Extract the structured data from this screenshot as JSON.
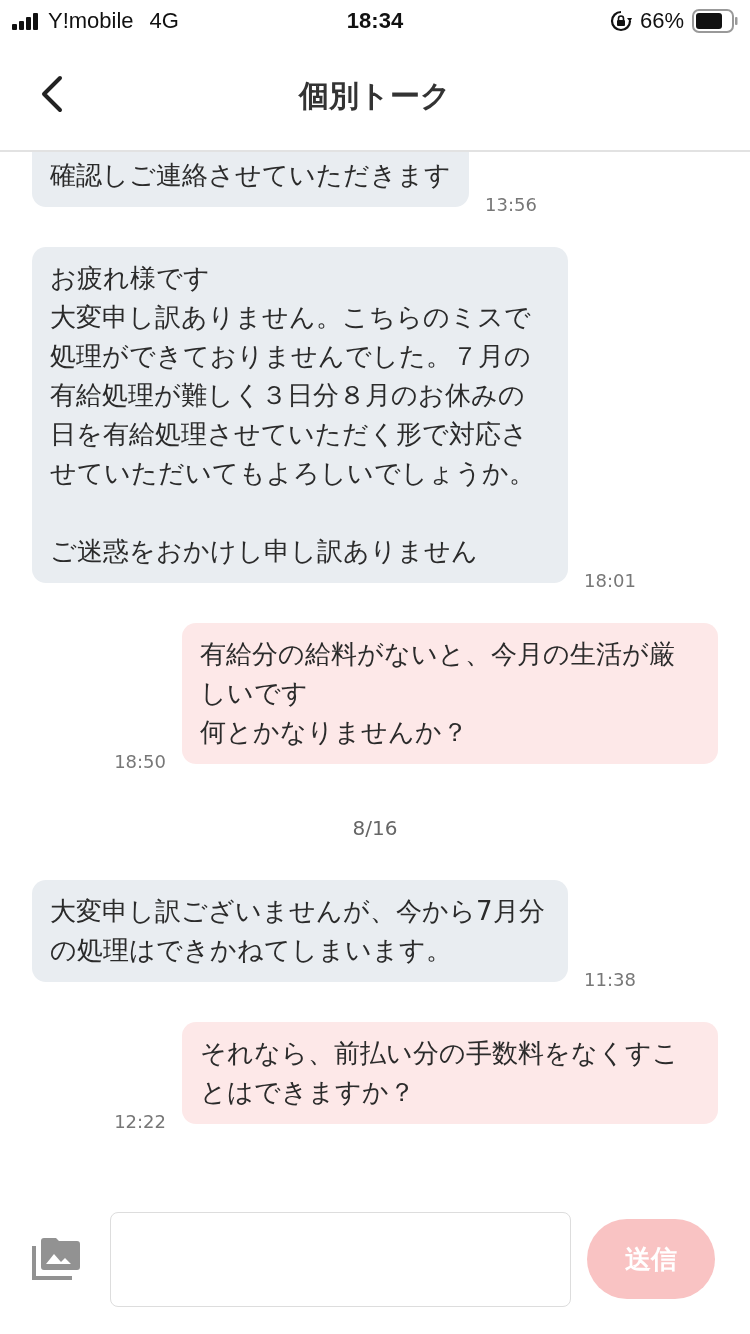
{
  "status_bar": {
    "carrier": "Y!mobile",
    "network": "4G",
    "time": "18:34",
    "battery": "66%"
  },
  "header": {
    "title": "個別トーク"
  },
  "messages": [
    {
      "kind": "incoming",
      "paragraphs": [
        [
          "確認しご連絡させていただきます"
        ]
      ],
      "time": "13:56"
    },
    {
      "kind": "incoming",
      "paragraphs": [
        [
          "お疲れ様です",
          "大変申し訳ありません。こちらのミスで処理ができておりませんでした。７月の有給処理が難しく３日分８月のお休みの日を有給処理させていただく形で対応させていただいてもよろしいでしょうか。"
        ],
        [
          "ご迷惑をおかけし申し訳ありません"
        ]
      ],
      "time": "18:01"
    },
    {
      "kind": "outgoing",
      "paragraphs": [
        [
          "有給分の給料がないと、今月の生活が厳しいです",
          "何とかなりませんか？"
        ]
      ],
      "time": "18:50"
    },
    {
      "kind": "date",
      "text": "8/16"
    },
    {
      "kind": "incoming",
      "paragraphs": [
        [
          "大変申し訳ございませんが、今から7月分の処理はできかねてしまいます。"
        ]
      ],
      "time": "11:38"
    },
    {
      "kind": "outgoing",
      "paragraphs": [
        [
          "それなら、前払い分の手数料をなくすことはできますか？"
        ]
      ],
      "time": "12:22"
    }
  ],
  "composer": {
    "send_label": "送信",
    "send_disabled": true
  }
}
